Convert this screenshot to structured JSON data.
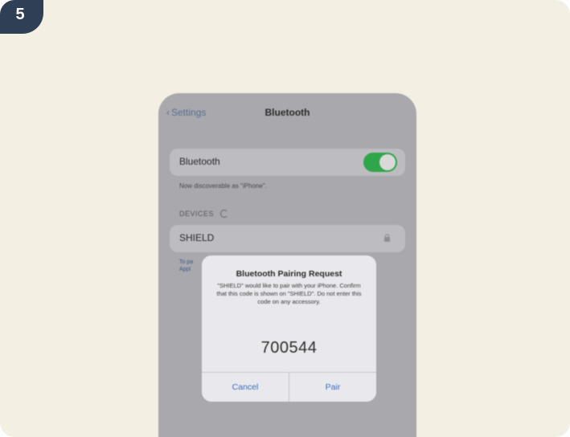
{
  "step": {
    "number": "5"
  },
  "status_bar": {
    "time": "",
    "signal": ""
  },
  "nav": {
    "back_label": "Settings",
    "title": "Bluetooth"
  },
  "bluetooth_row": {
    "label": "Bluetooth",
    "toggle_on": true
  },
  "footnote": "Now discoverable as \"iPhone\".",
  "devices_section": {
    "header": "DEVICES"
  },
  "device_row": {
    "name": "SHIELD"
  },
  "side_note": {
    "line1": "To pa",
    "line2": "Appl"
  },
  "dialog": {
    "title": "Bluetooth Pairing Request",
    "message": "\"SHIELD\" would like to pair with your iPhone. Confirm that this code is shown on \"SHIELD\". Do not enter this code on any accessory.",
    "code": "700544",
    "cancel_label": "Cancel",
    "pair_label": "Pair"
  },
  "colors": {
    "background": "#f4efe3",
    "badge": "#2f3f55",
    "toggle_on": "#30a64a",
    "link_blue": "#3e6dbf"
  }
}
